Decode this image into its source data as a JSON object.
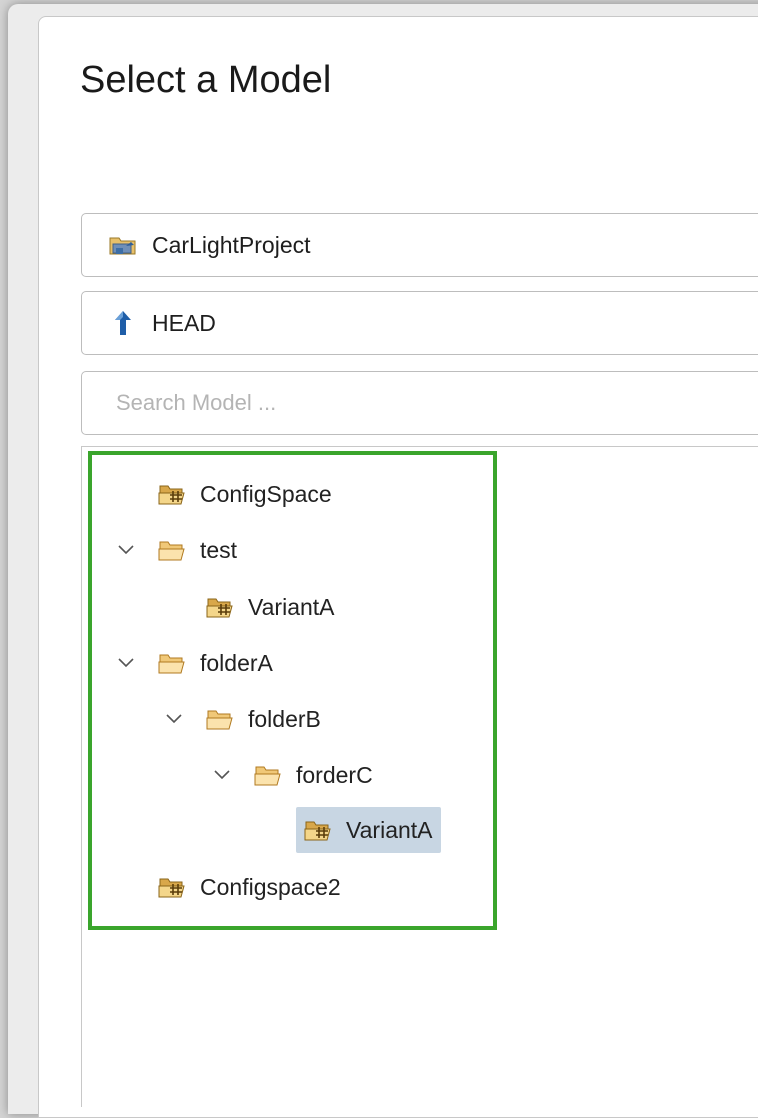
{
  "dialog": {
    "title": "Select a Model",
    "project": {
      "label": "CarLightProject",
      "icon": "project-icon"
    },
    "branch": {
      "label": "HEAD",
      "icon": "branch-up-arrow-icon"
    },
    "search": {
      "placeholder": "Search Model ..."
    }
  },
  "tree": {
    "highlight_color": "#3aa52c",
    "selection_color": "#c8d6e3",
    "nodes": [
      {
        "label": "ConfigSpace",
        "type": "configspace",
        "expanded": false,
        "selected": false
      },
      {
        "label": "test",
        "type": "folder",
        "expanded": true,
        "selected": false
      },
      {
        "label": "VariantA",
        "type": "configspace",
        "expanded": false,
        "selected": false
      },
      {
        "label": "folderA",
        "type": "folder",
        "expanded": true,
        "selected": false
      },
      {
        "label": "folderB",
        "type": "folder",
        "expanded": true,
        "selected": false
      },
      {
        "label": "forderC",
        "type": "folder",
        "expanded": true,
        "selected": false
      },
      {
        "label": "VariantA",
        "type": "configspace",
        "expanded": false,
        "selected": true
      },
      {
        "label": "Configspace2",
        "type": "configspace",
        "expanded": false,
        "selected": false
      }
    ]
  }
}
